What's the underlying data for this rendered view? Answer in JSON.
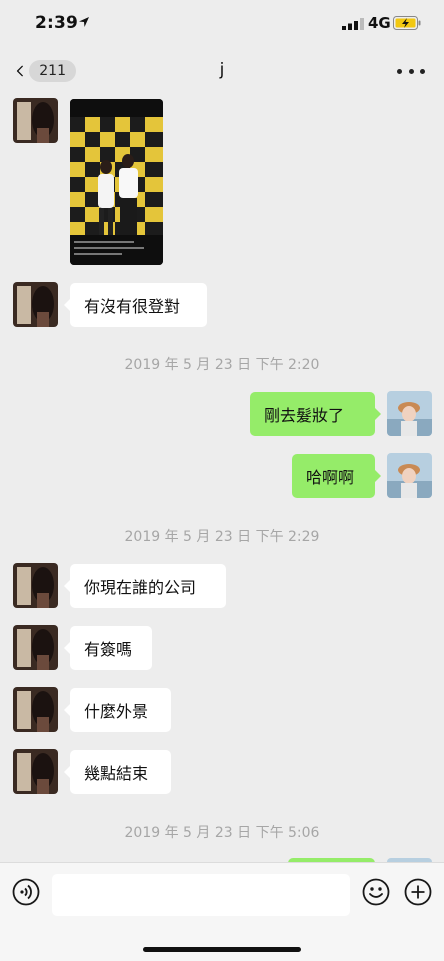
{
  "status": {
    "time": "2:39",
    "network": "4G"
  },
  "nav": {
    "back_count": "211",
    "title": "j"
  },
  "timestamps": [
    "2019 年 5 月 23 日 下午 2:20",
    "2019 年 5 月 23 日 下午 2:29",
    "2019 年 5 月 23 日 下午 5:06"
  ],
  "messages": {
    "m1": "有沒有很登對",
    "m2": "剛去髮妝了",
    "m3": "哈啊啊",
    "m4": "你現在誰的公司",
    "m5": "有簽嗎",
    "m6": "什麼外景",
    "m7": "幾點結束"
  },
  "input": {
    "value": ""
  },
  "colors": {
    "background": "#ededed",
    "outgoing_bubble": "#95ec69",
    "incoming_bubble": "#ffffff",
    "timestamp": "#a6a6a6"
  },
  "icons": [
    "location-arrow-icon",
    "signal-icon",
    "battery-charging-icon",
    "back-chevron-icon",
    "more-dots-icon",
    "voice-icon",
    "emoji-icon",
    "plus-icon"
  ]
}
